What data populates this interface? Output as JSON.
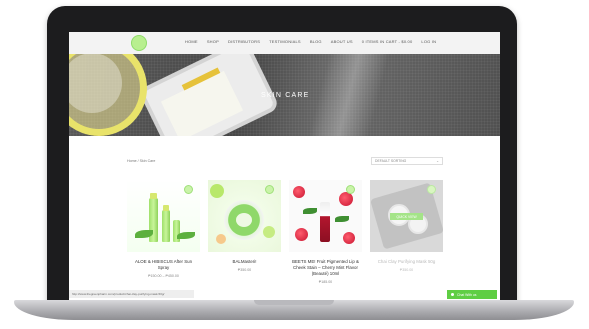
{
  "nav": {
    "logo_text": "LOGO",
    "items": [
      "HOME",
      "SHOP",
      "DISTRIBUTORS",
      "TESTIMONIALS",
      "BLOG",
      "ABOUT US",
      "0 ITEMS IN CART - $0.00",
      "LOG IN"
    ]
  },
  "hero": {
    "title": "SKIN CARE"
  },
  "shop": {
    "breadcrumb": "Home / Skin Care",
    "sort_value": "DEFAULT SORTING",
    "sort_arrow": "⌄"
  },
  "products": [
    {
      "name": "ALOE & HIBISCUS After Sun Spray",
      "price": "₱150.00 – ₱450.00"
    },
    {
      "name": "BALMasteri!",
      "price": "₱350.00"
    },
    {
      "name": "BEETS ME! Fruit Pigmented Lip & Cheek Stain – Cherry Mint Flavor (Beauté) 10ml",
      "price": "₱185.00"
    },
    {
      "name": "Chai Clay Purifying Mask 50g",
      "price": "₱350.00",
      "quick_view": "QUICK VIEW"
    }
  ],
  "status_url": "http://www.thegreenpharm.com/product/chai-clay-purifying-mask-50g/",
  "chat": {
    "label": "Chat With us"
  },
  "colors": {
    "accent_green": "#7ed957",
    "nav_bg": "#f3f3f3",
    "frame": "#1c1c1e"
  }
}
